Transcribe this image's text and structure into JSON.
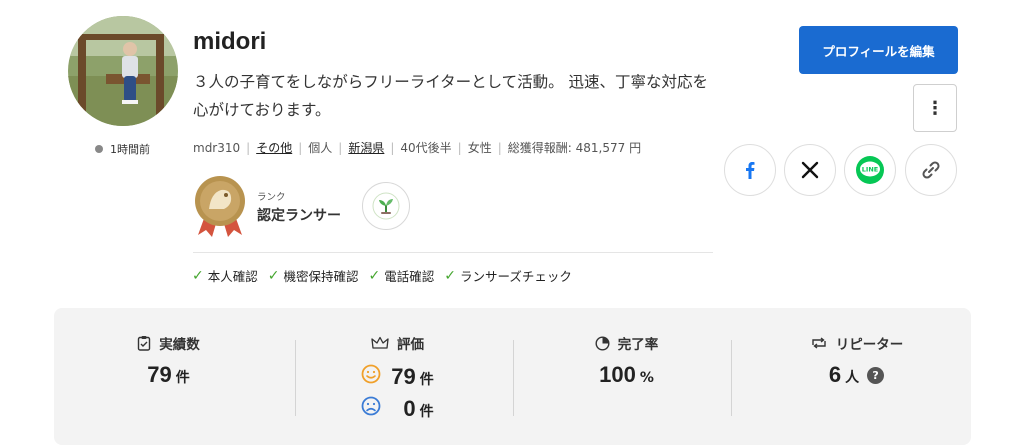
{
  "profile": {
    "name": "midori",
    "bio": "３人の子育てをしながらフリーライターとして活動。 迅速、丁寧な対応を心がけております。",
    "last_seen": "1時間前",
    "meta": {
      "user_id": "mdr310",
      "category": "その他",
      "type": "個人",
      "location": "新潟県",
      "age": "40代後半",
      "gender": "女性",
      "earnings": "総獲得報酬: 481,577 円"
    },
    "rank_label": "ランク",
    "rank_title": "認定ランサー",
    "verifications": [
      "本人確認",
      "機密保持確認",
      "電話確認",
      "ランサーズチェック"
    ]
  },
  "actions": {
    "edit_label": "プロフィールを編集",
    "more_icon": "⋮",
    "share": [
      "facebook-icon",
      "x-icon",
      "line-icon",
      "link-icon"
    ],
    "line_text": "LINE"
  },
  "stats": {
    "achievements": {
      "label": "実績数",
      "value": "79",
      "unit": "件"
    },
    "rating": {
      "label": "評価",
      "good": "79",
      "bad": "0",
      "unit": "件"
    },
    "completion": {
      "label": "完了率",
      "value": "100",
      "unit": "%"
    },
    "repeaters": {
      "label": "リピーター",
      "value": "6",
      "unit": "人",
      "help": "?"
    }
  },
  "colors": {
    "accent": "#1a6bd1",
    "check": "#45a62f",
    "good": "#f0a02a",
    "bad": "#3a7bd5",
    "facebook": "#1877f2",
    "line": "#06c755"
  }
}
